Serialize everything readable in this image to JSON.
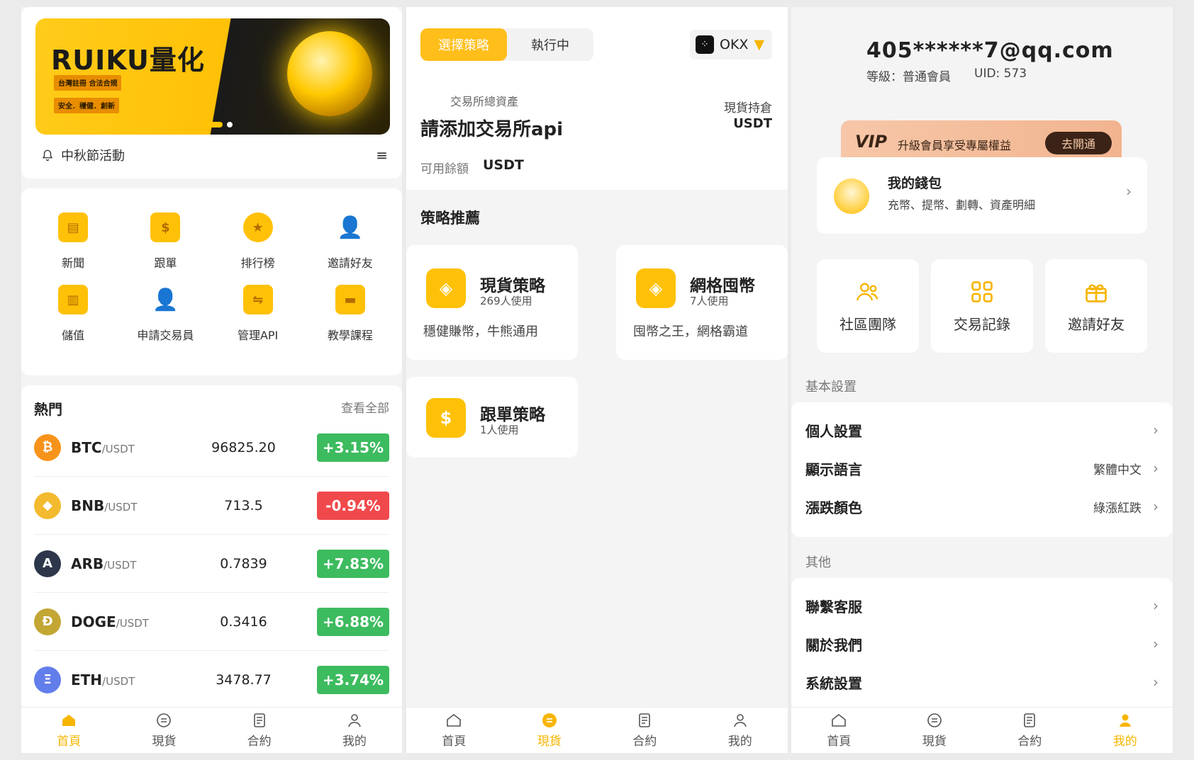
{
  "nav": {
    "home": "首頁",
    "spot": "現貨",
    "contract": "合約",
    "mine": "我的"
  },
  "home": {
    "banner": {
      "title": "RUIKU量化",
      "tag1": "台灣註冊 合法合規",
      "tag2": "安全．穩健．創新"
    },
    "notice": "中秋節活動",
    "grid": [
      "新聞",
      "跟單",
      "排行榜",
      "邀請好友",
      "儲值",
      "申請交易員",
      "管理API",
      "教學課程"
    ],
    "hot": {
      "title": "熱門",
      "more": "查看全部",
      "quote": "/USDT",
      "rows": [
        {
          "sym": "BTC",
          "price": "96825.20",
          "change": "+3.15%",
          "dir": "up",
          "color": "#f7931a",
          "glyph": "₿"
        },
        {
          "sym": "BNB",
          "price": "713.5",
          "change": "-0.94%",
          "dir": "down",
          "color": "#f3ba2f",
          "glyph": "◆"
        },
        {
          "sym": "ARB",
          "price": "0.7839",
          "change": "+7.83%",
          "dir": "up",
          "color": "#2d374b",
          "glyph": "A"
        },
        {
          "sym": "DOGE",
          "price": "0.3416",
          "change": "+6.88%",
          "dir": "up",
          "color": "#c3a634",
          "glyph": "Ð"
        },
        {
          "sym": "ETH",
          "price": "3478.77",
          "change": "+3.74%",
          "dir": "up",
          "color": "#627eea",
          "glyph": "Ξ"
        }
      ]
    }
  },
  "spot": {
    "tab_select": "選擇策略",
    "tab_running": "執行中",
    "exchange": "OKX",
    "total_label": "交易所總資產",
    "total_value": "請添加交易所api",
    "holding_label": "現貨持倉",
    "holding_unit": "USDT",
    "avail_label": "可用餘額",
    "avail_unit": "USDT",
    "rec_title": "策略推薦",
    "strategies": [
      {
        "name": "現貨策略",
        "users": "269人使用",
        "desc": "穩健賺幣，牛熊通用"
      },
      {
        "name": "網格囤幣",
        "users": "7人使用",
        "desc": "囤幣之王，網格霸道"
      },
      {
        "name": "跟單策略",
        "users": "1人使用",
        "desc": ""
      }
    ]
  },
  "mine": {
    "email": "405******7@qq.com",
    "level": "等級：普通會員",
    "uid": "UID: 573",
    "vip_logo": "VIP",
    "vip_text": "升級會員享受專屬權益",
    "vip_btn": "去開通",
    "wallet_title": "我的錢包",
    "wallet_sub": "充幣、提幣、劃轉、資產明細",
    "tiles": [
      "社區團隊",
      "交易記錄",
      "邀請好友"
    ],
    "basic_label": "基本設置",
    "basic": [
      {
        "label": "個人設置",
        "value": ""
      },
      {
        "label": "顯示語言",
        "value": "繁體中文"
      },
      {
        "label": "漲跌顏色",
        "value": "綠漲紅跌"
      }
    ],
    "other_label": "其他",
    "other": [
      {
        "label": "聯繫客服"
      },
      {
        "label": "關於我們"
      },
      {
        "label": "系統設置"
      }
    ]
  }
}
